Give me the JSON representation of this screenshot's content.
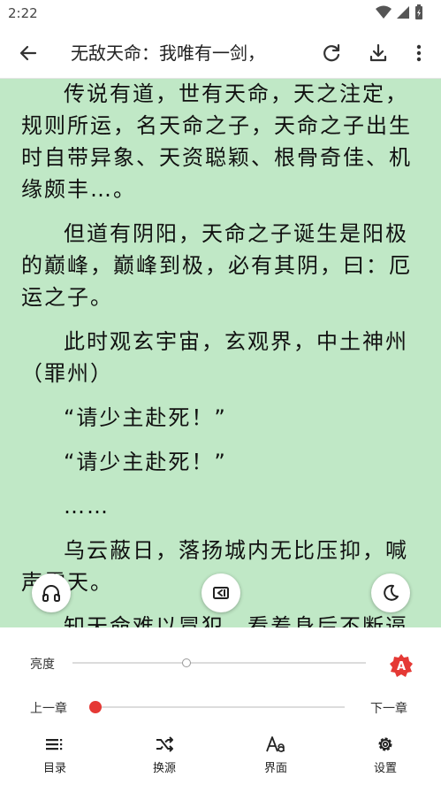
{
  "status_bar": {
    "time": "2:22"
  },
  "toolbar": {
    "title": "无敌天命：我唯有一剑，"
  },
  "content": {
    "paragraphs": [
      "传说有道，世有天命，天之注定，规则所运，名天命之子，天命之子出生时自带异象、天资聪颖、根骨奇佳、机缘颇丰…。",
      "但道有阴阳，天命之子诞生是阳极的巅峰，巅峰到极，必有其阴，曰：厄运之子。",
      "此时观玄宇宙，玄观界，中土神州（罪州）",
      "“请少主赴死！”",
      "“请少主赴死！”",
      "……",
      "乌云蔽日，落扬城内无比压抑，喊声震天。",
      "知天命难以冒犯，看着身后不断逼近的族人以及城中百姓，瞳孔剧"
    ]
  },
  "panel": {
    "brightness_label": "亮度",
    "brightness_level": 0.39,
    "auto_badge": "A",
    "prev_chapter": "上一章",
    "next_chapter": "下一章",
    "chapter_progress": 0.0,
    "nav": [
      {
        "label": "目录",
        "icon": "list-icon"
      },
      {
        "label": "换源",
        "icon": "shuffle-icon"
      },
      {
        "label": "界面",
        "icon": "font-icon"
      },
      {
        "label": "设置",
        "icon": "gear-icon"
      }
    ]
  },
  "colors": {
    "page_background": "#c0e8c6",
    "accent": "#e53935"
  }
}
